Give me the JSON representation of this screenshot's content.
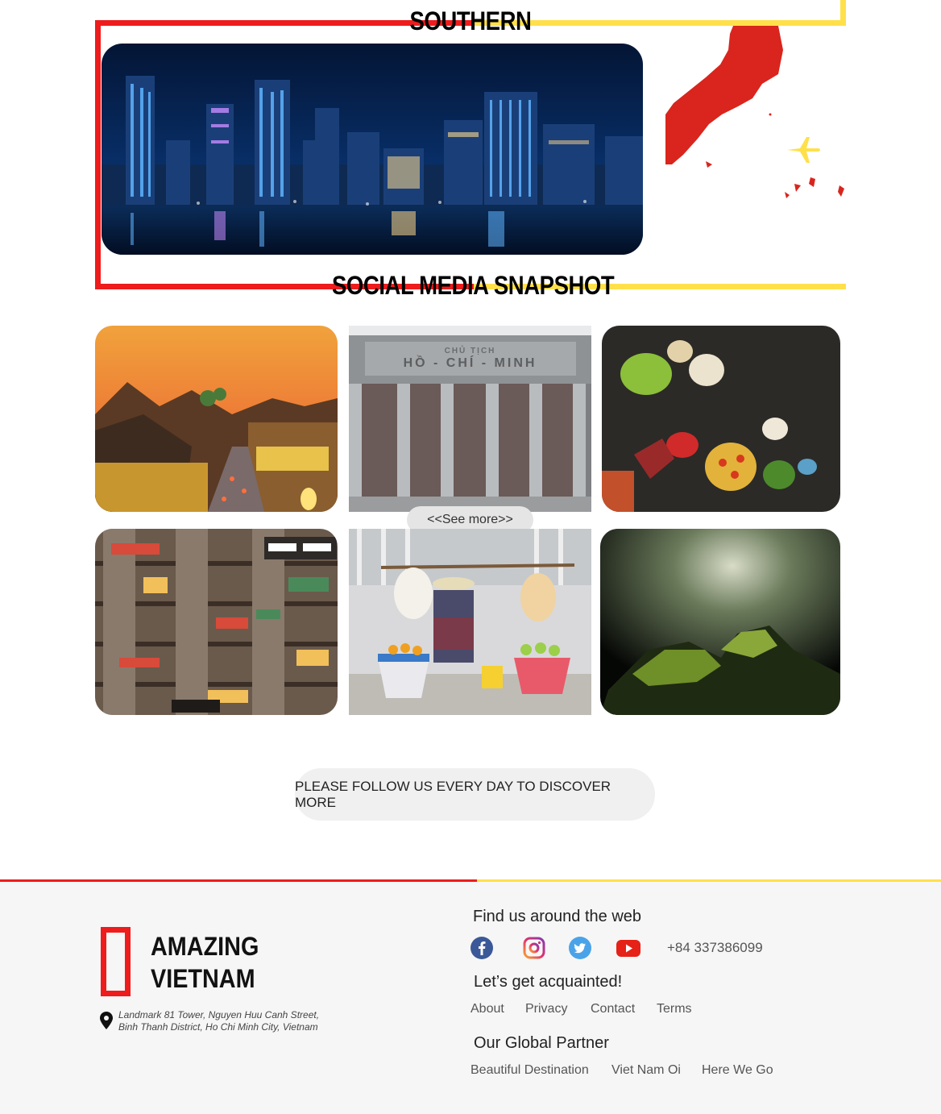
{
  "sections": {
    "southern_title": "SOUTHERN",
    "social_title": "SOCIAL MEDIA SNAPSHOT"
  },
  "gallery": {
    "see_more": "<<See more>>",
    "monument_text_top": "CHỦ TỊCH",
    "monument_text_main": "HỒ - CHÍ - MINH",
    "photos": [
      "hoi-an-old-town",
      "ho-chi-minh-mausoleum",
      "floating-fruit-market",
      "apartment-cafes",
      "street-fruit-vendor",
      "cave-light"
    ]
  },
  "cta": {
    "label": "PLEASE FOLLOW US EVERY DAY TO DISCOVER MORE"
  },
  "footer": {
    "brand_line1": "AMAZING",
    "brand_line2": "VIETNAM",
    "address_line1": "Landmark 81 Tower, Nguyen Huu Canh Street,",
    "address_line2": "Binh Thanh District, Ho Chi Minh City, Vietnam",
    "find_us": "Find us around the web",
    "phone": "+84 337386099",
    "acquainted": "Let’s get acquainted!",
    "links": [
      "About",
      "Privacy",
      "Contact",
      "Terms"
    ],
    "partner_title": "Our Global Partner",
    "partners": [
      "Beautiful Destination",
      "Viet Nam Oi",
      "Here We Go"
    ]
  },
  "colors": {
    "red": "#ee1c1c",
    "yellow": "#ffe04a",
    "map_red": "#d9251d",
    "footer_bg": "#f6f6f6"
  },
  "icons": [
    "facebook-icon",
    "instagram-icon",
    "twitter-icon",
    "youtube-icon",
    "location-pin-icon",
    "airplane-icon"
  ]
}
